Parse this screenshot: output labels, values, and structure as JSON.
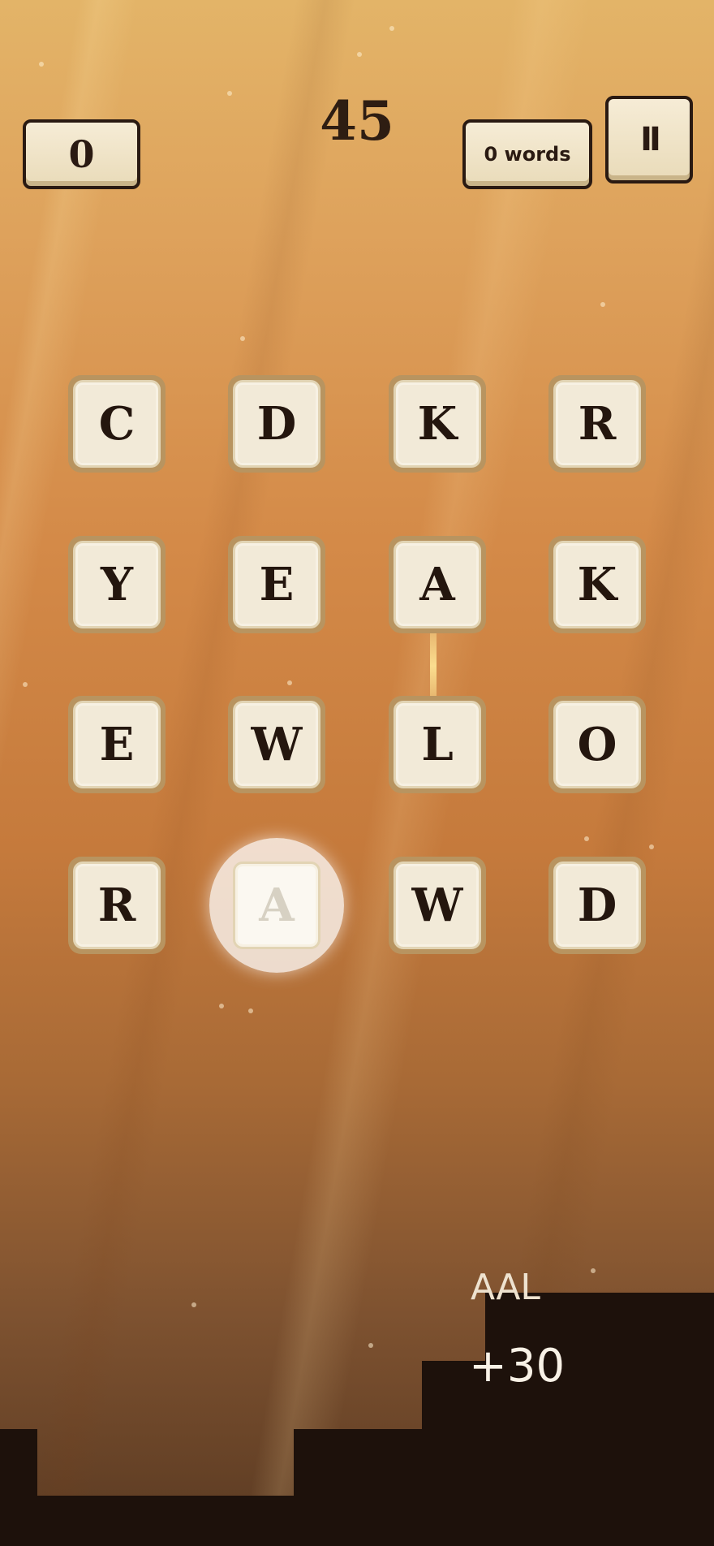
{
  "hud": {
    "score": "0",
    "timer": "45",
    "words_found": "0 words",
    "pause_icon": "II"
  },
  "board": {
    "rows": [
      [
        "C",
        "D",
        "K",
        "R"
      ],
      [
        "Y",
        "E",
        "A",
        "K"
      ],
      [
        "E",
        "W",
        "L",
        "O"
      ],
      [
        "R",
        "A",
        "W",
        "D"
      ]
    ],
    "active_tile": "A"
  },
  "feedback": {
    "word": "AAL",
    "points": "+30"
  },
  "icons": {
    "pause": "pause-icon"
  },
  "colors": {
    "tile_face": "#f2ead8",
    "tile_border": "#b89460",
    "ink": "#24160e",
    "ground": "#1d110b"
  }
}
